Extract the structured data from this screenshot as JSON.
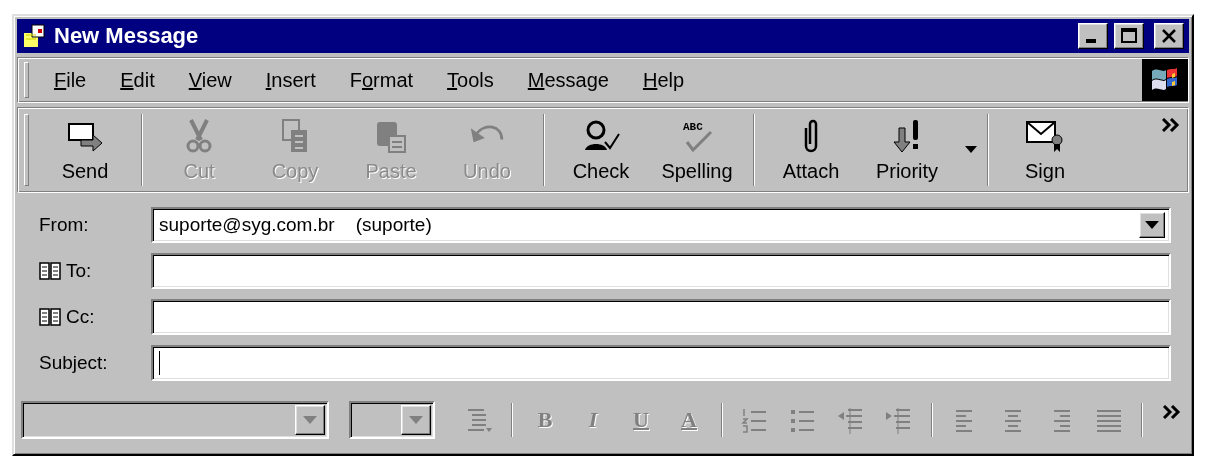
{
  "window": {
    "title": "New Message"
  },
  "menu": [
    {
      "key": "F",
      "after": "ile"
    },
    {
      "key": "E",
      "after": "dit"
    },
    {
      "key": "V",
      "after": "iew"
    },
    {
      "key": "I",
      "after": "nsert"
    },
    {
      "before": "F",
      "key": "o",
      "after": "rmat"
    },
    {
      "key": "T",
      "after": "ools"
    },
    {
      "key": "M",
      "after": "essage"
    },
    {
      "key": "H",
      "after": "elp"
    }
  ],
  "toolbar": [
    [
      {
        "kind": "send",
        "label": "Send",
        "disabled": false
      }
    ],
    [
      {
        "kind": "cut",
        "label": "Cut",
        "disabled": true
      },
      {
        "kind": "copy",
        "label": "Copy",
        "disabled": true
      },
      {
        "kind": "paste",
        "label": "Paste",
        "disabled": true
      },
      {
        "kind": "undo",
        "label": "Undo",
        "disabled": true
      }
    ],
    [
      {
        "kind": "check",
        "label": "Check",
        "disabled": false
      },
      {
        "kind": "spelling",
        "label": "Spelling",
        "icon_text": "ABC",
        "disabled": false
      }
    ],
    [
      {
        "kind": "attach",
        "label": "Attach",
        "disabled": false
      },
      {
        "kind": "priority",
        "label": "Priority",
        "disabled": false,
        "dropdown": true
      }
    ],
    [
      {
        "kind": "sign",
        "label": "Sign",
        "disabled": false
      }
    ]
  ],
  "fields": [
    {
      "kind": "dropdown",
      "label": "From:",
      "value": "suporte@syg.com.br    (suporte)",
      "address_book": false,
      "focused": false
    },
    {
      "kind": "text",
      "label": "To:",
      "address_book": true,
      "focused": false
    },
    {
      "kind": "text",
      "label": "Cc:",
      "address_book": true,
      "focused": false
    },
    {
      "kind": "text",
      "label": "Subject:",
      "address_book": false,
      "focused": true
    }
  ],
  "format_bar": [
    [
      {
        "kind": "font-list",
        "disabled": true
      },
      {
        "kind": "size-list",
        "disabled": true
      },
      {
        "kind": "paragraph",
        "disabled": true
      }
    ],
    [
      {
        "kind": "bold",
        "label": "B",
        "disabled": true
      },
      {
        "kind": "italic",
        "label": "I",
        "disabled": true
      },
      {
        "kind": "underline",
        "label": "U",
        "disabled": true
      },
      {
        "kind": "font-color",
        "label": "A",
        "disabled": true
      }
    ],
    [
      {
        "kind": "numbers",
        "disabled": true
      },
      {
        "kind": "bullets",
        "disabled": true
      },
      {
        "kind": "outdent",
        "disabled": true
      },
      {
        "kind": "indent",
        "disabled": true
      }
    ],
    [
      {
        "kind": "align-left",
        "disabled": true
      },
      {
        "kind": "align-center",
        "disabled": true
      },
      {
        "kind": "align-right",
        "disabled": true
      },
      {
        "kind": "justify",
        "disabled": true
      }
    ]
  ]
}
